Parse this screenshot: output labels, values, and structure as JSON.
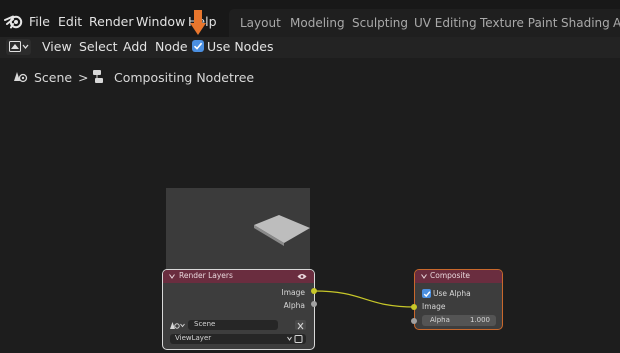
{
  "top_menu": {
    "file": "File",
    "edit": "Edit",
    "render": "Render",
    "window": "Window",
    "help": "Help"
  },
  "workspaces": [
    "Layout",
    "Modeling",
    "Sculpting",
    "UV Editing",
    "Texture Paint",
    "Shading",
    "A"
  ],
  "node_header": {
    "view": "View",
    "select": "Select",
    "add": "Add",
    "node": "Node",
    "use_nodes": "Use Nodes",
    "use_nodes_checked": true
  },
  "breadcrumb": {
    "scene": "Scene",
    "separator": ">",
    "tree": "Compositing Nodetree"
  },
  "render_layers_node": {
    "title": "Render Layers",
    "outputs": [
      "Image",
      "Alpha"
    ],
    "scene_field": "Scene",
    "view_layer_field": "ViewLayer"
  },
  "composite_node": {
    "title": "Composite",
    "use_alpha_label": "Use Alpha",
    "use_alpha_checked": true,
    "inputs": [
      "Image"
    ],
    "alpha_label": "Alpha",
    "alpha_value": "1.000"
  },
  "colors": {
    "accent": "#4b8fe0",
    "node_header": "#6a2d3f",
    "image_socket": "#c7c729",
    "value_socket": "#a1a1a1",
    "pointer": "#e8762d"
  },
  "icons": [
    "blender-logo-icon",
    "editor-type-icon",
    "checkbox-icon",
    "scene-icon",
    "node-tree-icon",
    "eye-icon",
    "close-icon",
    "chevron-down-icon",
    "pointer-arrow-icon"
  ]
}
